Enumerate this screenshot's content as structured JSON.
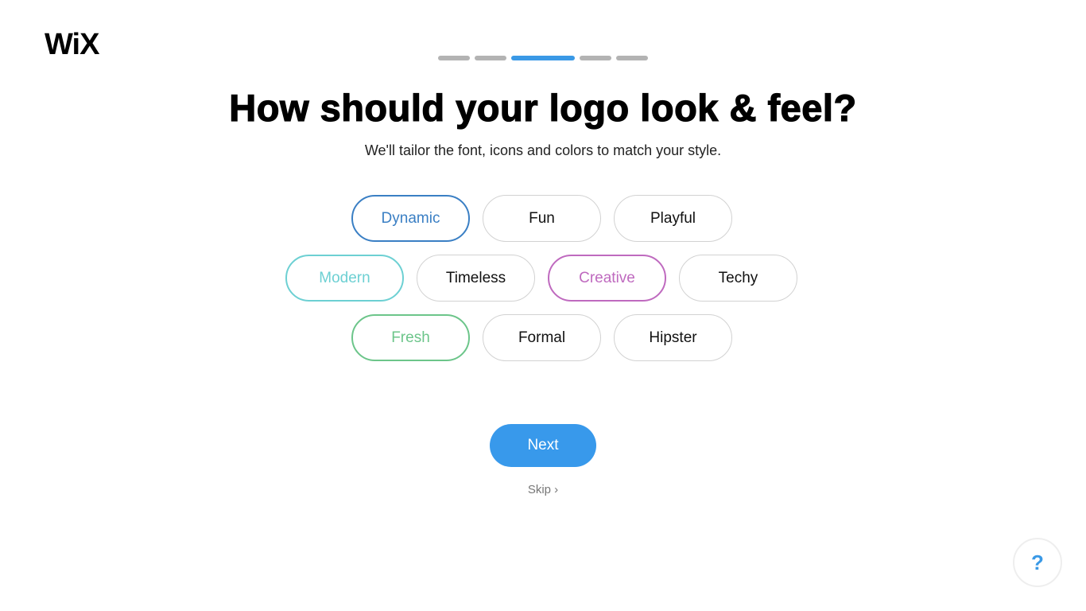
{
  "brand": {
    "logo_text": "WiX"
  },
  "progress": {
    "total_steps": 5,
    "current_step": 3
  },
  "header": {
    "title": "How should your logo look & feel?",
    "subtitle": "We'll tailor the font, icons and colors to match your style."
  },
  "styles": [
    {
      "label": "Dynamic",
      "selected": true,
      "color": "#3a7fc4"
    },
    {
      "label": "Fun",
      "selected": false,
      "color": "#111111"
    },
    {
      "label": "Playful",
      "selected": false,
      "color": "#111111"
    },
    {
      "label": "Modern",
      "selected": true,
      "color": "#6dd0d3"
    },
    {
      "label": "Timeless",
      "selected": false,
      "color": "#111111"
    },
    {
      "label": "Creative",
      "selected": true,
      "color": "#bf6abf"
    },
    {
      "label": "Techy",
      "selected": false,
      "color": "#111111"
    },
    {
      "label": "Fresh",
      "selected": true,
      "color": "#6cc58a"
    },
    {
      "label": "Formal",
      "selected": false,
      "color": "#111111"
    },
    {
      "label": "Hipster",
      "selected": false,
      "color": "#111111"
    }
  ],
  "actions": {
    "next_label": "Next",
    "skip_label": "Skip",
    "skip_icon": "chevron-right-icon"
  },
  "help": {
    "label": "?"
  }
}
